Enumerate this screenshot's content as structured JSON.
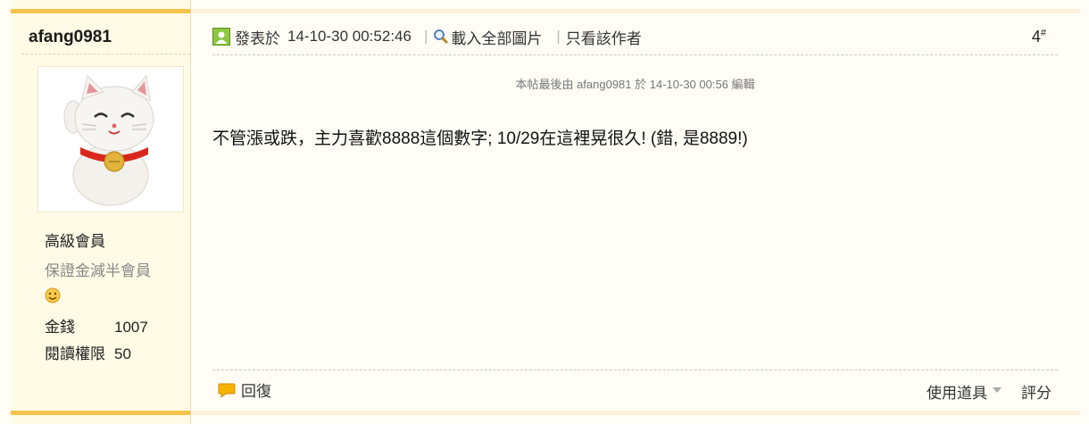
{
  "author": {
    "username": "afang0981",
    "rank": "高級會員",
    "subrank": "保證金減半會員",
    "stats": [
      {
        "key": "金錢",
        "value": "1007"
      },
      {
        "key": "閱讀權限",
        "value": "50"
      }
    ]
  },
  "post": {
    "posted_label": "發表於",
    "posted_time": "14-10-30 00:52:46",
    "load_images": "載入全部圖片",
    "only_author": "只看該作者",
    "floor_number": "4",
    "floor_mark": "#",
    "edited_note": "本帖最後由 afang0981 於 14-10-30 00:56 編輯",
    "content": "不管漲或跌，主力喜歡8888這個數字; 10/29在這裡晃很久! (錯, 是8889!)"
  },
  "footer": {
    "reply": "回復",
    "use_tool": "使用道具",
    "rate": "評分"
  },
  "colors": {
    "accent_bar": "#f5c44c",
    "sidebar_bg": "#fffbe6",
    "page_bg": "#fffdf6"
  }
}
